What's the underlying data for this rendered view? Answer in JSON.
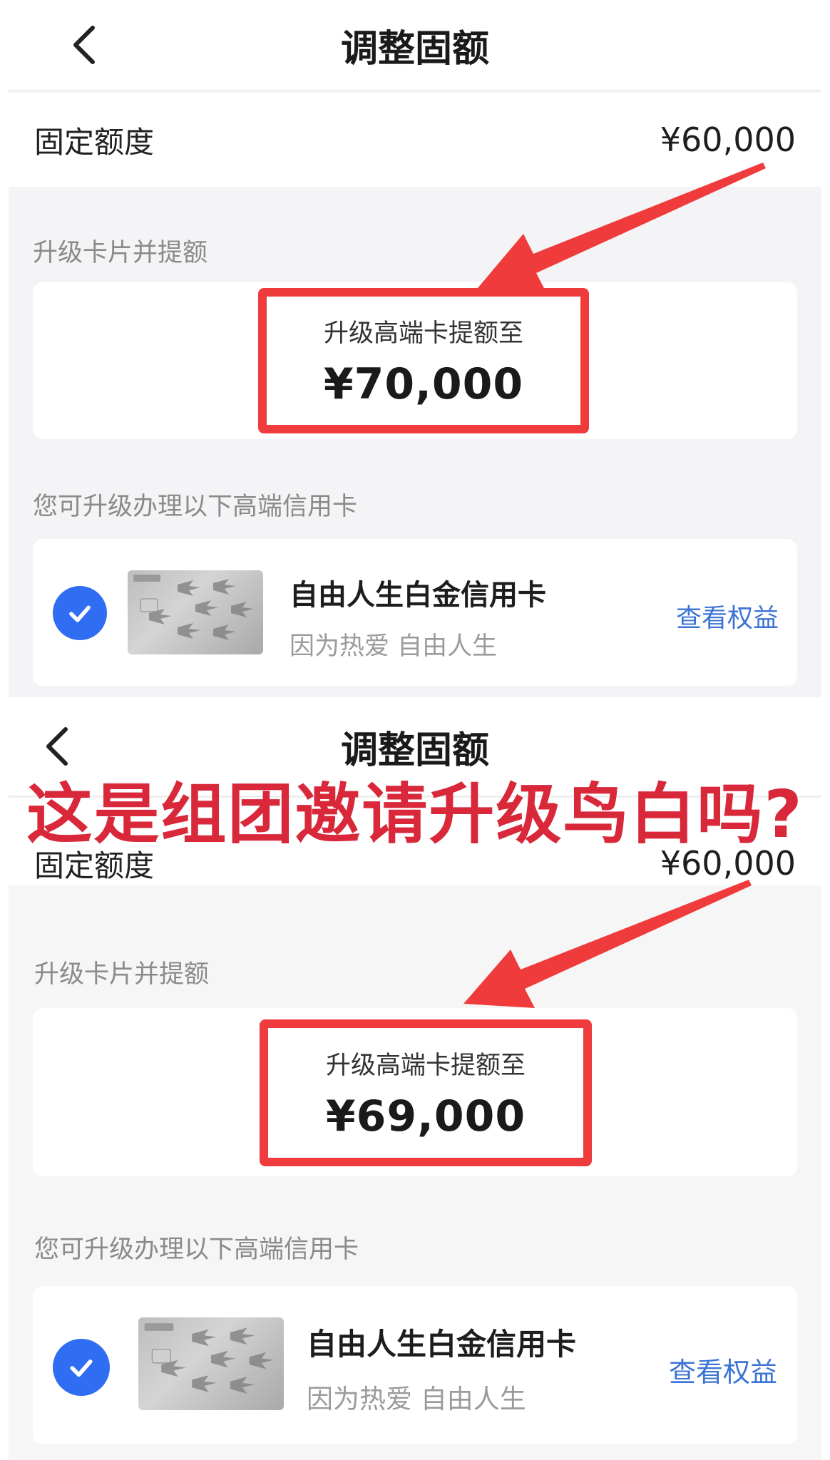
{
  "caption": "这是组团邀请升级鸟白吗?",
  "colors": {
    "accent_red": "#ef3b3b",
    "caption_red": "#d8283a",
    "check_blue": "#2f6df2",
    "link_blue": "#3b74d6"
  },
  "screens": [
    {
      "header": {
        "title": "调整固额",
        "back_icon": "chevron-left-icon"
      },
      "fixed_limit": {
        "label": "固定额度",
        "value": "¥60,000"
      },
      "upgrade_section": {
        "label": "升级卡片并提额",
        "box_title": "升级高端卡提额至",
        "box_amount": "¥70,000"
      },
      "cards_section": {
        "label": "您可升级办理以下高端信用卡",
        "card": {
          "name": "自由人生白金信用卡",
          "slogan": "因为热爱 自由人生",
          "benefits_link": "查看权益",
          "checked": true
        }
      }
    },
    {
      "header": {
        "title": "调整固额",
        "back_icon": "chevron-left-icon"
      },
      "fixed_limit": {
        "label": "固定额度",
        "value": "¥60,000"
      },
      "upgrade_section": {
        "label": "升级卡片并提额",
        "box_title": "升级高端卡提额至",
        "box_amount": "¥69,000"
      },
      "cards_section": {
        "label": "您可升级办理以下高端信用卡",
        "card": {
          "name": "自由人生白金信用卡",
          "slogan": "因为热爱 自由人生",
          "benefits_link": "查看权益",
          "checked": true
        }
      }
    }
  ]
}
